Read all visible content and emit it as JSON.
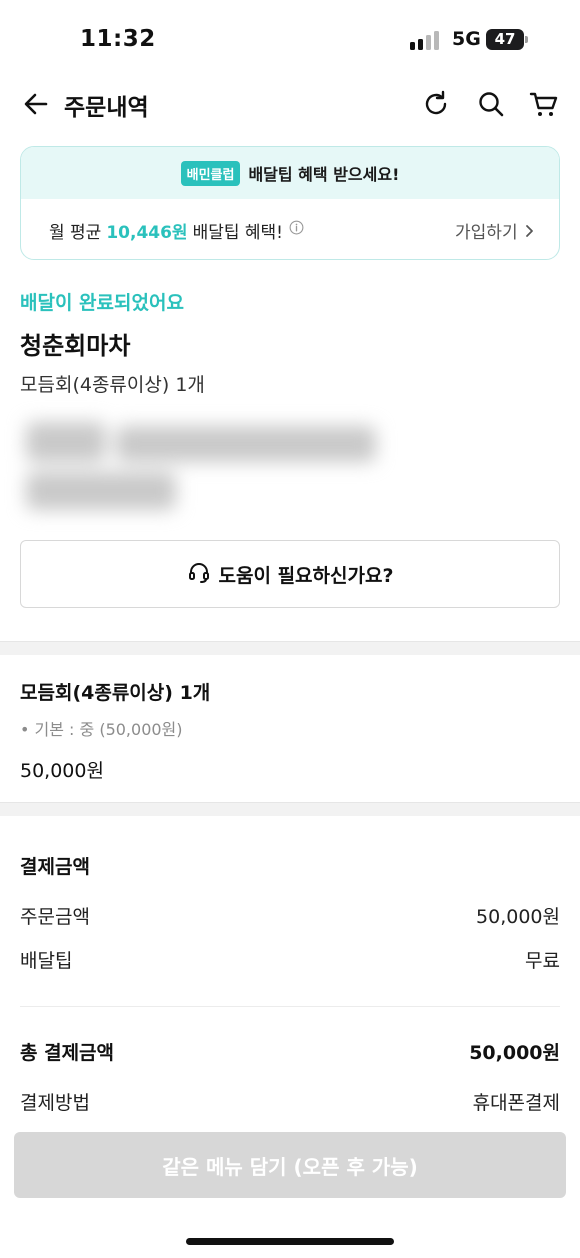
{
  "status_bar": {
    "time": "11:32",
    "network": "5G",
    "battery": "47",
    "signal_bars_filled": 2,
    "signal_bars_total": 4
  },
  "header": {
    "title": "주문내역",
    "icons": [
      "back-arrow-icon",
      "refresh-icon",
      "search-icon",
      "cart-icon"
    ]
  },
  "club_banner": {
    "badge": "배민클럽",
    "promo": "배달팁 혜택 받으세요!",
    "prefix": "월 평균",
    "amount": "10,446원",
    "suffix": "배달팁 혜택!",
    "join": "가입하기"
  },
  "order": {
    "status": "배달이 완료되었어요",
    "store_name": "청춘회마차",
    "item_summary": "모듬회(4종류이상) 1개"
  },
  "help": {
    "label": "도움이 필요하신가요?"
  },
  "menu_detail": {
    "name": "모듬회(4종류이상) 1개",
    "option": "• 기본 : 중 (50,000원)",
    "price": "50,000원"
  },
  "payment": {
    "heading": "결제금액",
    "order_amount_label": "주문금액",
    "order_amount_value": "50,000원",
    "delivery_tip_label": "배달팁",
    "delivery_tip_value": "무료",
    "total_label": "총 결제금액",
    "total_value": "50,000원",
    "method_label": "결제방법",
    "method_value": "휴대폰결제"
  },
  "cta": {
    "label": "같은 메뉴 담기 (오픈 후 가능)",
    "enabled": false
  },
  "colors": {
    "accent": "#2ac1bc",
    "banner_bg": "#e6f8f7",
    "disabled_button": "#d7d7d7"
  }
}
